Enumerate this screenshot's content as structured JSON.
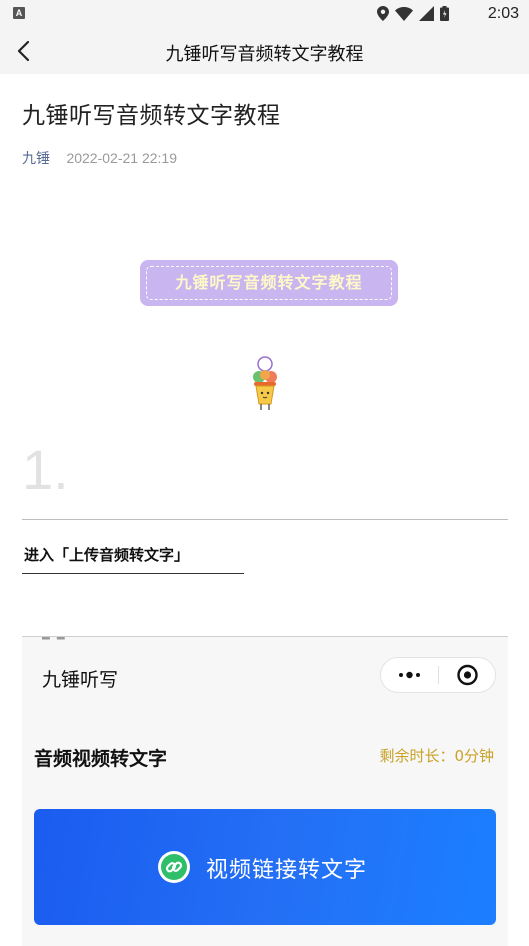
{
  "status_bar": {
    "notification_badge": "A",
    "time": "2:03",
    "icons": [
      "location-icon",
      "wifi-icon",
      "signal-icon",
      "battery-icon"
    ]
  },
  "nav": {
    "title": "九锤听写音频转文字教程",
    "back_icon": "chevron-left-icon"
  },
  "article": {
    "title": "九锤听写音频转文字教程",
    "author": "九锤",
    "date": "2022-02-21 22:19",
    "tag_text": "九锤听写音频转文字教程",
    "step_number": "1.",
    "step_label": "进入「上传音频转文字」"
  },
  "embedded_screenshot": {
    "app_title": "九锤听写",
    "section_title": "音频视频转文字",
    "remaining_time": "剩余时长：0分钟",
    "button_label": "视频链接转文字",
    "button_icon": "link-icon",
    "capsule_icons": [
      "more-dots-icon",
      "target-close-icon"
    ]
  },
  "colors": {
    "author_link": "#576b95",
    "tag_bg": "#c9b5f0",
    "remaining_time": "#c9a227",
    "button_bg": "#1a66f2"
  }
}
